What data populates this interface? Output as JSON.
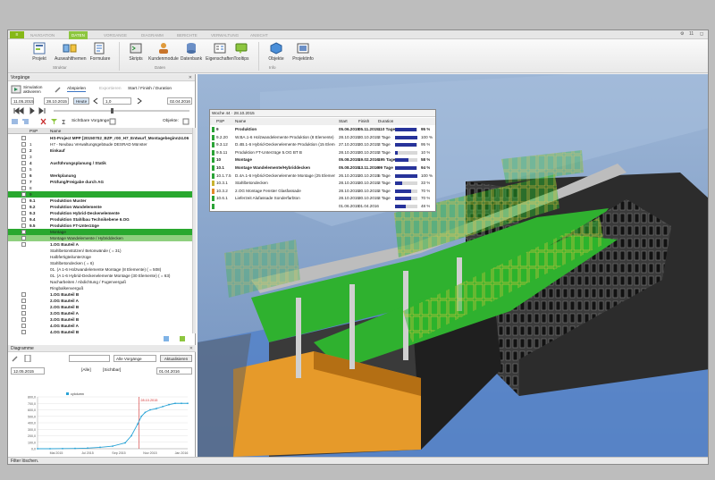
{
  "ribbon": {
    "app_button": "≡",
    "tabs": [
      "NAVIGATION",
      "DATEN",
      "VORGANGE",
      "DIAGRAMM",
      "BERICHTE",
      "VERWALTUNG",
      "ANSICHT"
    ],
    "active_tab": "DATEN",
    "right_items": [
      "⚙",
      "11",
      "◻"
    ],
    "buttons": [
      {
        "label": "Projekt",
        "icon": "project-icon"
      },
      {
        "label": "Auswahlthemen",
        "icon": "selection-themes-icon"
      },
      {
        "label": "Formulare",
        "icon": "forms-icon"
      },
      {
        "label": "Skripts",
        "icon": "scripts-icon"
      },
      {
        "label": "Kundenmodule",
        "icon": "customer-modules-icon"
      },
      {
        "label": "Datenbank",
        "icon": "database-icon"
      },
      {
        "label": "Eigenschaften",
        "icon": "properties-icon"
      },
      {
        "label": "Tooltips",
        "icon": "tooltips-icon"
      },
      {
        "label": "Objekte",
        "icon": "objects-icon"
      },
      {
        "label": "Projektinfo",
        "icon": "project-info-icon"
      }
    ],
    "groups": [
      "Struktur",
      "Daten",
      "Info"
    ]
  },
  "vorgaenge_panel": {
    "title": "Vorgänge",
    "simulate_label": "Simulation aktivieren",
    "tabs": [
      "Abspielen",
      "Exportieren",
      "Start / Finish / Duration"
    ],
    "date_start": "11.05.2015",
    "date_current": "28.10.2015",
    "today_button": "Heute",
    "speed_value": "1,0",
    "date_end": "02.04.2016",
    "visible_label": "Sichtbare Vorgänge:",
    "objects_label": "Objekte:",
    "columns": [
      "PSP",
      "Name"
    ],
    "rows": [
      {
        "psp": "",
        "name": "HS-Project MPP [20150702_BZP_r00_H7_Entwurf_Montagebeginn24.06",
        "style": "b",
        "exp": true
      },
      {
        "psp": "1",
        "name": "H7 - Neubau Verwaltungsgebäude DESRAD Münster",
        "style": "",
        "exp": true
      },
      {
        "psp": "2",
        "name": "Einkauf",
        "style": "b",
        "exp": true
      },
      {
        "psp": "3",
        "name": "",
        "style": "",
        "exp": true
      },
      {
        "psp": "4",
        "name": "Ausführungsplanung / Statik",
        "style": "b",
        "exp": true
      },
      {
        "psp": "5",
        "name": "",
        "style": "",
        "exp": true
      },
      {
        "psp": "6",
        "name": "Werkplanung",
        "style": "b",
        "exp": true
      },
      {
        "psp": "7",
        "name": "Prüfung/Freigabe durch AG",
        "style": "b",
        "exp": true
      },
      {
        "psp": "8",
        "name": "",
        "style": "",
        "exp": true
      },
      {
        "psp": "9",
        "name": "",
        "style": "g",
        "exp": true
      },
      {
        "psp": "9.1",
        "name": "Produktion Muster",
        "style": "b",
        "exp": true
      },
      {
        "psp": "9.2",
        "name": "Produktion Wandelemente",
        "style": "b",
        "exp": true
      },
      {
        "psp": "9.3",
        "name": "Produktion Hybrid-Deckenelemente",
        "style": "b",
        "exp": true
      },
      {
        "psp": "9.4",
        "name": "Produktion Stahlbau Technikebene 6.OG",
        "style": "b",
        "exp": true
      },
      {
        "psp": "9.5",
        "name": "Produktion FT-Unterzüge",
        "style": "b",
        "exp": true
      },
      {
        "psp": "",
        "name": "Montage",
        "style": "g",
        "exp": true
      },
      {
        "psp": "",
        "name": "Montage Wandelemente / Hybriddecken",
        "style": "gl",
        "exp": true
      },
      {
        "psp": "",
        "name": "1.OG Bauteil A",
        "style": "b",
        "exp": true
      },
      {
        "psp": "",
        "name": "Stahlbetonstützen/ Betonwände ( = 31)",
        "style": "",
        "exp": false
      },
      {
        "psp": "",
        "name": "Halbfertigteilunterzüge",
        "style": "",
        "exp": false
      },
      {
        "psp": "",
        "name": "Stahlbetondecken ( = 6)",
        "style": "",
        "exp": false
      },
      {
        "psp": "",
        "name": "01. (A 1-6 Holzwandelemente Montage (8 Elemente) ( = 508)",
        "style": "",
        "exp": false
      },
      {
        "psp": "",
        "name": "01. (A 1-6 Hybrid-Deckenelemente Montage (30 Elemente) ( = 63)",
        "style": "",
        "exp": false
      },
      {
        "psp": "",
        "name": "Nacharbeiten / Abdichtung / Fugenverguß",
        "style": "",
        "exp": false
      },
      {
        "psp": "",
        "name": "Ringbalkenverguß",
        "style": "",
        "exp": false
      },
      {
        "psp": "",
        "name": "1.OG Bauteil B",
        "style": "b",
        "exp": true
      },
      {
        "psp": "",
        "name": "2.OG Bauteil A",
        "style": "b",
        "exp": true
      },
      {
        "psp": "",
        "name": "2.OG Bauteil B",
        "style": "b",
        "exp": true
      },
      {
        "psp": "",
        "name": "3.OG Bauteil A",
        "style": "b",
        "exp": true
      },
      {
        "psp": "",
        "name": "3.OG Bauteil B",
        "style": "b",
        "exp": true
      },
      {
        "psp": "",
        "name": "4.OG Bauteil A",
        "style": "b",
        "exp": true
      },
      {
        "psp": "",
        "name": "4.OG Bauteil B",
        "style": "b",
        "exp": true
      }
    ]
  },
  "diagramme_panel": {
    "title": "Diagramme",
    "filter_value": "Alle Vorgänge",
    "refresh_button": "Aktualisieren",
    "date_from": "12.05.2015",
    "all_label": "[Alle]",
    "visible_label": "[Sichtbar]",
    "date_to": "01.04.2016"
  },
  "chart_data": {
    "type": "line",
    "legend": [
      "cylolumn"
    ],
    "x": [
      "Mai 2015",
      "Jul 2015",
      "Sep 2015",
      "Nov 2015",
      "Jan 2016"
    ],
    "y_ticks": [
      "0,0",
      "100,0",
      "200,0",
      "300,0",
      "400,0",
      "500,0",
      "600,0",
      "700,0",
      "800,0"
    ],
    "ylim": [
      0,
      800
    ],
    "marker_label": "28.10.2015",
    "series": [
      {
        "name": "cylolumn",
        "values": [
          [
            0,
            0
          ],
          [
            1,
            0
          ],
          [
            2,
            2
          ],
          [
            3,
            5
          ],
          [
            4,
            10
          ],
          [
            5,
            22
          ],
          [
            6,
            40
          ],
          [
            7,
            90
          ],
          [
            7.5,
            200
          ],
          [
            8,
            380
          ],
          [
            8.3,
            500
          ],
          [
            8.6,
            560
          ],
          [
            9,
            600
          ],
          [
            9.5,
            620
          ],
          [
            10,
            650
          ],
          [
            10.5,
            680
          ],
          [
            11,
            700
          ],
          [
            11.5,
            700
          ],
          [
            12,
            700
          ]
        ]
      }
    ],
    "x_range": [
      0,
      12
    ]
  },
  "overlay": {
    "title": "Woche 44 · 28.10.2015",
    "columns": [
      "PSP",
      "Name",
      "Start",
      "Finish",
      "Duration"
    ],
    "rows": [
      {
        "psp": "9",
        "name": "Produktion",
        "start": "05.06.2015",
        "finish": "05.11.2015",
        "duration": "110 Tage",
        "pct": "95 %",
        "frac": 0.95,
        "color": "#2aa336",
        "bold": true
      },
      {
        "psp": "9.2.20",
        "name": "W.BA.1-6 Holzwandelemente Produktion (8 Elemente)",
        "start": "28.10.2015",
        "finish": "30.10.2015",
        "duration": "3 Tage",
        "pct": "100 %",
        "frac": 1,
        "color": "#2aa336",
        "bold": false
      },
      {
        "psp": "9.3.12",
        "name": "D.4B.1-6 Hybrid-Deckenelemente Produktion (15 Elemente)",
        "start": "27.10.2015",
        "finish": "30.10.2015",
        "duration": "3 Tage",
        "pct": "95 %",
        "frac": 0.95,
        "color": "#2aa336",
        "bold": false
      },
      {
        "psp": "9.5.11",
        "name": "Produktion FT-Unterzüge 5.OG BT B",
        "start": "28.10.2015",
        "finish": "30.10.2015",
        "duration": "3 Tage",
        "pct": "10 %",
        "frac": 0.1,
        "color": "#2aa336",
        "bold": false
      },
      {
        "psp": "10",
        "name": "Montage",
        "start": "05.08.2015",
        "finish": "19.02.2016",
        "duration": "195 Tage",
        "pct": "58 %",
        "frac": 0.58,
        "color": "#2aa336",
        "bold": true
      },
      {
        "psp": "10.1",
        "name": "Montage Wandelemente/Hybriddecken",
        "start": "05.08.2015",
        "finish": "13.11.2016",
        "duration": "99 Tage",
        "pct": "94 %",
        "frac": 0.94,
        "color": "#2aa336",
        "bold": true
      },
      {
        "psp": "10.1.7.5",
        "name": "D.4A.1-6 Hybrid-Deckenelemente Montage (25 Elemente)",
        "start": "26.10.2015",
        "finish": "30.10.2015",
        "duration": "5 Tage",
        "pct": "100 %",
        "frac": 1,
        "color": "#2aa336",
        "bold": false
      },
      {
        "psp": "10.3.1",
        "name": "Stahlbetondecken",
        "start": "28.10.2015",
        "finish": "30.10.2015",
        "duration": "3 Tage",
        "pct": "33 %",
        "frac": 0.33,
        "color": "#c8b230",
        "bold": false
      },
      {
        "psp": "10.3.2",
        "name": "2.OG Montage Fenster Glasfassade",
        "start": "28.10.2015",
        "finish": "30.10.2015",
        "duration": "3 Tage",
        "pct": "70 %",
        "frac": 0.7,
        "color": "#e2892b",
        "bold": false
      },
      {
        "psp": "10.6.1",
        "name": "Lieferzeit Alufassade Sonderfarbton",
        "start": "28.10.2015",
        "finish": "30.10.2015",
        "duration": "3 Tage",
        "pct": "70 %",
        "frac": 0.7,
        "color": "#2aa336",
        "bold": false
      },
      {
        "psp": "",
        "name": "",
        "start": "01.06.2015",
        "finish": "01.04.2016",
        "duration": "",
        "pct": "48 %",
        "frac": 0.48,
        "color": "#2aa336",
        "bold": false
      }
    ]
  },
  "view": {
    "home_label": "home"
  },
  "status_text": "Filter löschen."
}
